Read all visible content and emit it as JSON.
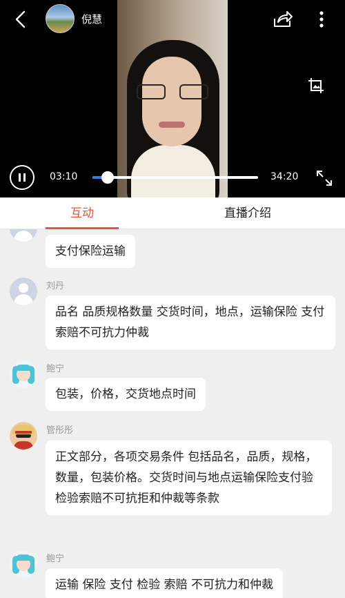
{
  "player": {
    "host_name": "倪慧",
    "current_time": "03:10",
    "total_time": "34:20",
    "progress": 0.092
  },
  "tabs": [
    {
      "label": "互动",
      "active": true
    },
    {
      "label": "直播介绍",
      "active": false
    }
  ],
  "messages": [
    {
      "sender": "",
      "avatar": "default-user-avatar",
      "text": "支付保险运输"
    },
    {
      "sender": "刘丹",
      "avatar": "default-user-avatar",
      "text": "品名 品质规格数量 交货时间，地点，运输保险 支付 索赔不可抗力仲裁"
    },
    {
      "sender": "鲍宁",
      "avatar": "anime-girl-avatar",
      "text": "包装，价格，交货地点时间"
    },
    {
      "sender": "管彤彤",
      "avatar": "straw-hat-avatar",
      "text": "正文部分，各项交易条件 包括品名，品质，规格，数量，包装价格。交货时间与地点运输保险支付验检验索赔不可抗拒和仲裁等条款"
    },
    {
      "sender": "鲍宁",
      "avatar": "anime-girl-avatar",
      "text": "运输 保险 支付 检验 索赔 不可抗力和仲裁"
    }
  ],
  "colors": {
    "accent": "#e8553e",
    "progress": "#2f7ce8",
    "chat_background": "#efefef",
    "player_background": "#000000"
  }
}
